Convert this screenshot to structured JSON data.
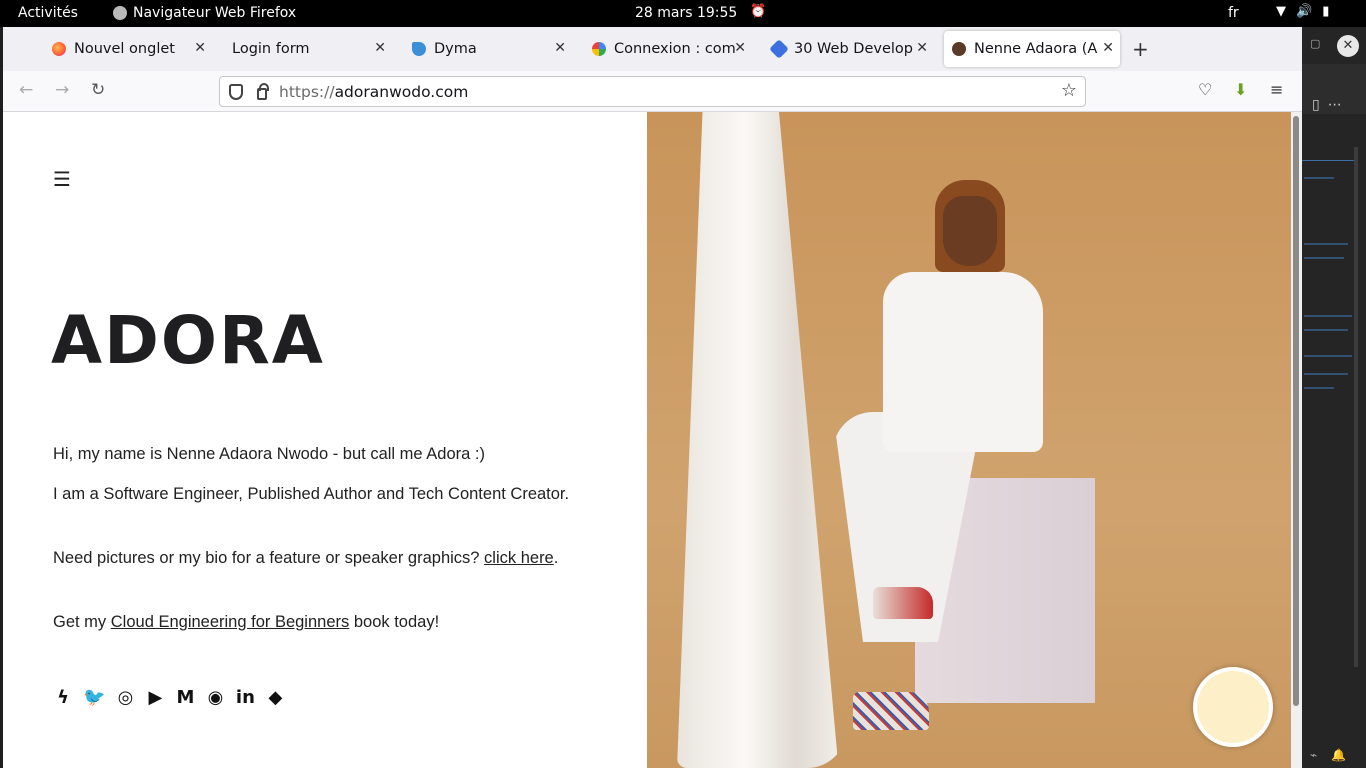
{
  "topbar": {
    "activities": "Activités",
    "app_name": "Navigateur Web Firefox",
    "datetime": "28 mars  19:55",
    "language": "fr"
  },
  "browser": {
    "tabs": [
      {
        "title": "Nouvel onglet",
        "favicon": "firefox-icon"
      },
      {
        "title": "Login form",
        "favicon": "none"
      },
      {
        "title": "Dyma",
        "favicon": "dyma-icon"
      },
      {
        "title": "Connexion : com",
        "favicon": "google-icon"
      },
      {
        "title": "30 Web Develop",
        "favicon": "blue-diamond-icon"
      },
      {
        "title": "Nenne Adaora (A",
        "favicon": "portrait-icon",
        "active": true
      }
    ],
    "url_protocol": "https://",
    "url_host": "adoranwodo.com"
  },
  "page": {
    "brand": "ADORA",
    "intro": "Hi, my name is Nenne Adaora Nwodo - but call me Adora :)",
    "role": "I am a Software Engineer, Published Author and Tech Content Creator.",
    "press_prefix": "Need pictures or my bio for a feature or speaker graphics? ",
    "press_link": "click here",
    "press_suffix": ".",
    "book_prefix": "Get my ",
    "book_link": "Cloud Engineering for Beginners",
    "book_suffix": " book today!",
    "socials": [
      "hashnode-icon",
      "twitter-icon",
      "instagram-icon",
      "youtube-icon",
      "medium-icon",
      "github-icon",
      "linkedin-icon",
      "dev-icon"
    ],
    "social_glyphs": [
      "ϟ",
      "🐦",
      "◎",
      "▶",
      "M",
      "◉",
      "in",
      "◆"
    ]
  },
  "colors": {
    "photo_background": "#c99a62",
    "fab": "#fdf0c8",
    "text": "#222222"
  }
}
